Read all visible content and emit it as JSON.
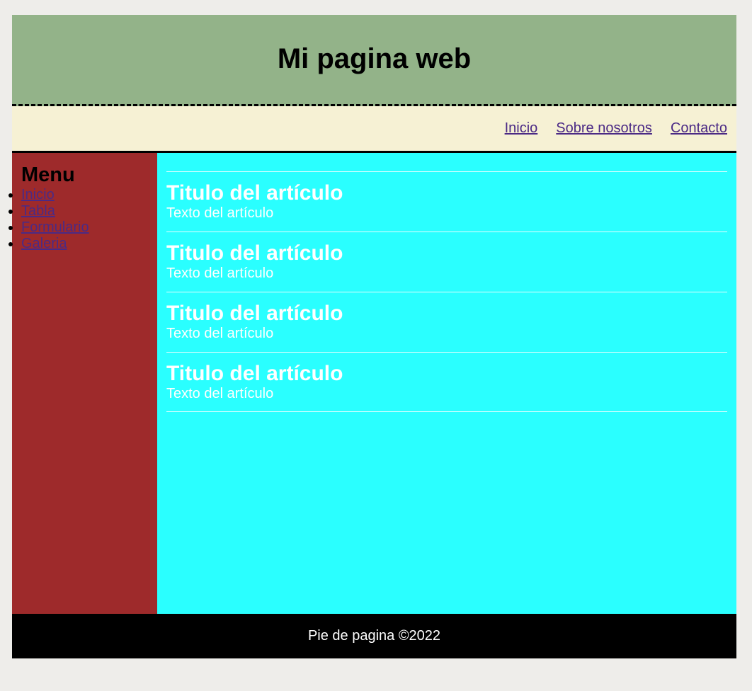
{
  "header": {
    "title": "Mi pagina web"
  },
  "topnav": {
    "links": [
      "Inicio",
      "Sobre nosotros",
      "Contacto"
    ]
  },
  "sidebar": {
    "title": "Menu",
    "items": [
      "Inicio",
      "Tabla",
      "Formulario",
      "Galeria"
    ]
  },
  "articles": [
    {
      "title": "Titulo del artículo",
      "text": "Texto del artículo"
    },
    {
      "title": "Titulo del artículo",
      "text": "Texto del artículo"
    },
    {
      "title": "Titulo del artículo",
      "text": "Texto del artículo"
    },
    {
      "title": "Titulo del artículo",
      "text": "Texto del artículo"
    }
  ],
  "footer": {
    "text": "Pie de pagina ©2022"
  },
  "colors": {
    "header_bg": "#93b389",
    "nav_bg": "#f6f1d4",
    "sidebar_bg": "#9e2a2b",
    "content_bg": "#2affff",
    "footer_bg": "#000000",
    "link": "#4b2a85"
  }
}
